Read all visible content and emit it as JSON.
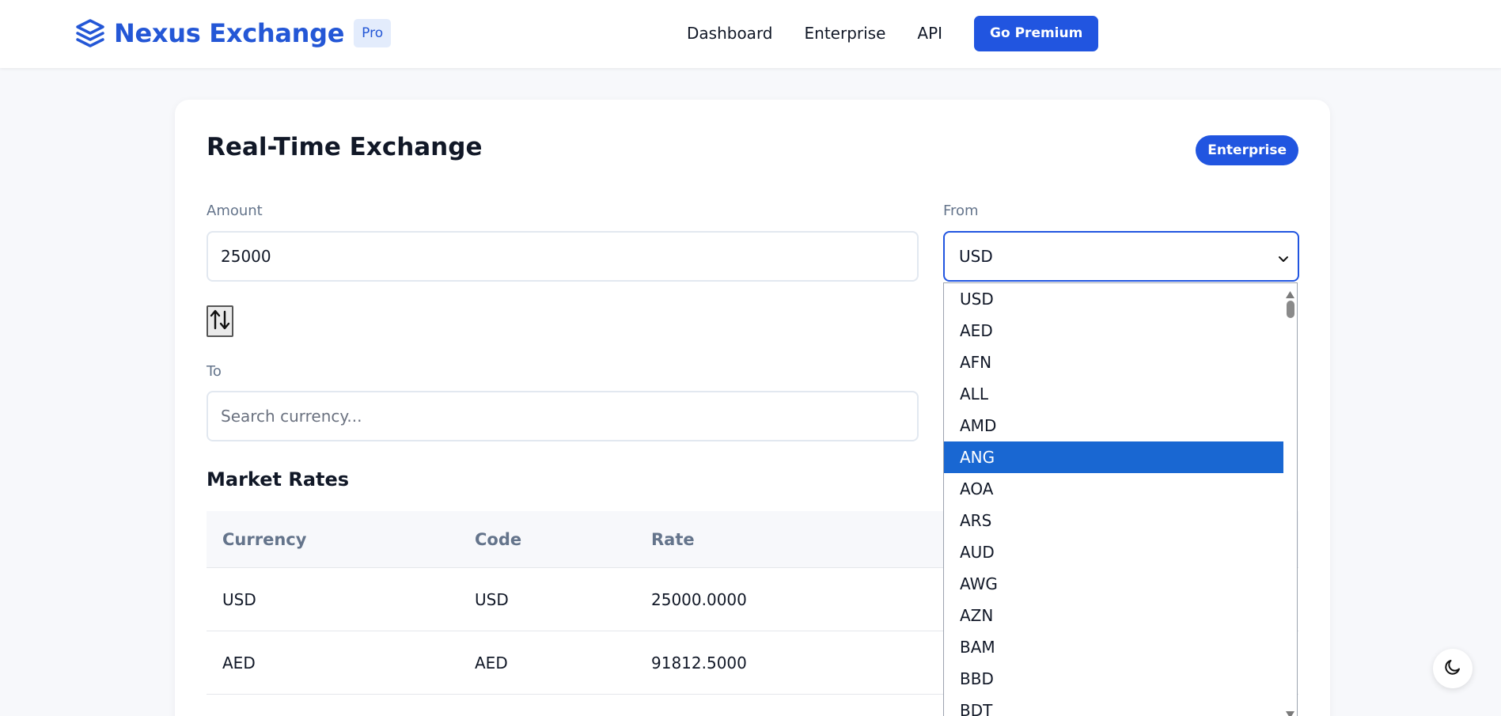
{
  "header": {
    "brand_name": "Nexus Exchange",
    "brand_badge": "Pro",
    "brand_icon": "layers-icon",
    "nav": [
      "Dashboard",
      "Enterprise",
      "API"
    ],
    "cta_label": "Go Premium"
  },
  "converter": {
    "title": "Real-Time Exchange",
    "tier_badge": "Enterprise",
    "amount_label": "Amount",
    "amount_value": "25000",
    "from_label": "From",
    "from_value": "USD",
    "to_label": "To",
    "to_placeholder": "Search currency...",
    "swap_icon": "swap-arrows-icon"
  },
  "market_rates": {
    "title": "Market Rates",
    "columns": [
      "Currency",
      "Code",
      "Rate"
    ],
    "rows": [
      {
        "currency": "USD",
        "code": "USD",
        "rate": "25000.0000"
      },
      {
        "currency": "AED",
        "code": "AED",
        "rate": "91812.5000"
      }
    ]
  },
  "dropdown": {
    "options": [
      "USD",
      "AED",
      "AFN",
      "ALL",
      "AMD",
      "ANG",
      "AOA",
      "ARS",
      "AUD",
      "AWG",
      "AZN",
      "BAM",
      "BBD",
      "BDT"
    ],
    "highlighted": "ANG"
  },
  "theme_toggle_icon": "moon-icon",
  "colors": {
    "accent": "#2155e0",
    "highlight": "#1967d2",
    "muted_text": "#64748b"
  }
}
